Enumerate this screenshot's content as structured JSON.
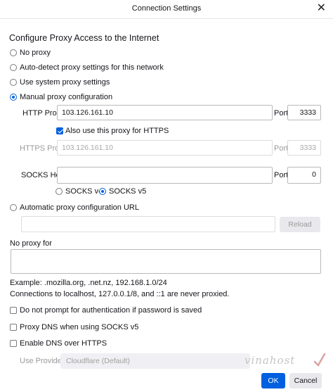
{
  "window": {
    "title": "Connection Settings",
    "close_glyph": "✕"
  },
  "heading": "Configure Proxy Access to the Internet",
  "proxy_options": {
    "no_proxy": "No proxy",
    "auto_detect": "Auto-detect proxy settings for this network",
    "system": "Use system proxy settings",
    "manual": "Manual proxy configuration",
    "automatic_url": "Automatic proxy configuration URL",
    "selected": "manual"
  },
  "manual": {
    "http_proxy_label": "HTTP Proxy",
    "http_proxy_value": "103.126.161.10",
    "http_port_label": "Port",
    "http_port_value": "3333",
    "also_https_label": "Also use this proxy for HTTPS",
    "also_https_checked": true,
    "https_proxy_label": "HTTPS Proxy",
    "https_proxy_value": "103.126.161.10",
    "https_port_label": "Port",
    "https_port_value": "3333",
    "socks_host_label": "SOCKS Host",
    "socks_host_value": "",
    "socks_port_label": "Port",
    "socks_port_value": "0",
    "socks_v4_label": "SOCKS v4",
    "socks_v5_label": "SOCKS v5",
    "socks_selected": "v5"
  },
  "auto_url": {
    "value": "",
    "reload_label": "Reload"
  },
  "no_proxy_for": {
    "label": "No proxy for",
    "value": "",
    "example": "Example: .mozilla.org, .net.nz, 192.168.1.0/24",
    "localhost_note": "Connections to localhost, 127.0.0.1/8, and ::1 are never proxied."
  },
  "options": {
    "no_auth_prompt": "Do not prompt for authentication if password is saved",
    "proxy_dns_socks5": "Proxy DNS when using SOCKS v5",
    "enable_doh": "Enable DNS over HTTPS"
  },
  "doh": {
    "provider_label": "Use Provider",
    "provider_value": "Cloudflare (Default)"
  },
  "watermark": "vinahost",
  "buttons": {
    "ok": "OK",
    "cancel": "Cancel"
  },
  "colors": {
    "accent": "#0060df",
    "text": "#15141a",
    "disabled": "#9a9a9a"
  }
}
